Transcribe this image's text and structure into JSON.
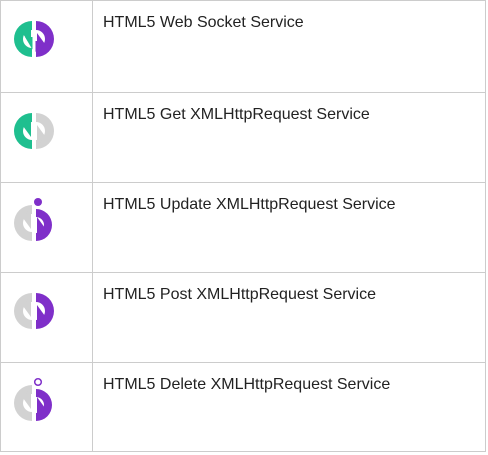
{
  "colors": {
    "teal": "#1FBF8F",
    "purple": "#7F2FC9",
    "gray": "#D2D2D2",
    "border": "#CCCCCC"
  },
  "services": [
    {
      "label": "HTML5 Web Socket Service",
      "icon": "websocket-service-icon"
    },
    {
      "label": "HTML5 Get XMLHttpRequest Service",
      "icon": "get-service-icon"
    },
    {
      "label": "HTML5 Update XMLHttpRequest Service",
      "icon": "update-service-icon"
    },
    {
      "label": "HTML5 Post XMLHttpRequest Service",
      "icon": "post-service-icon"
    },
    {
      "label": "HTML5 Delete XMLHttpRequest Service",
      "icon": "delete-service-icon"
    }
  ]
}
